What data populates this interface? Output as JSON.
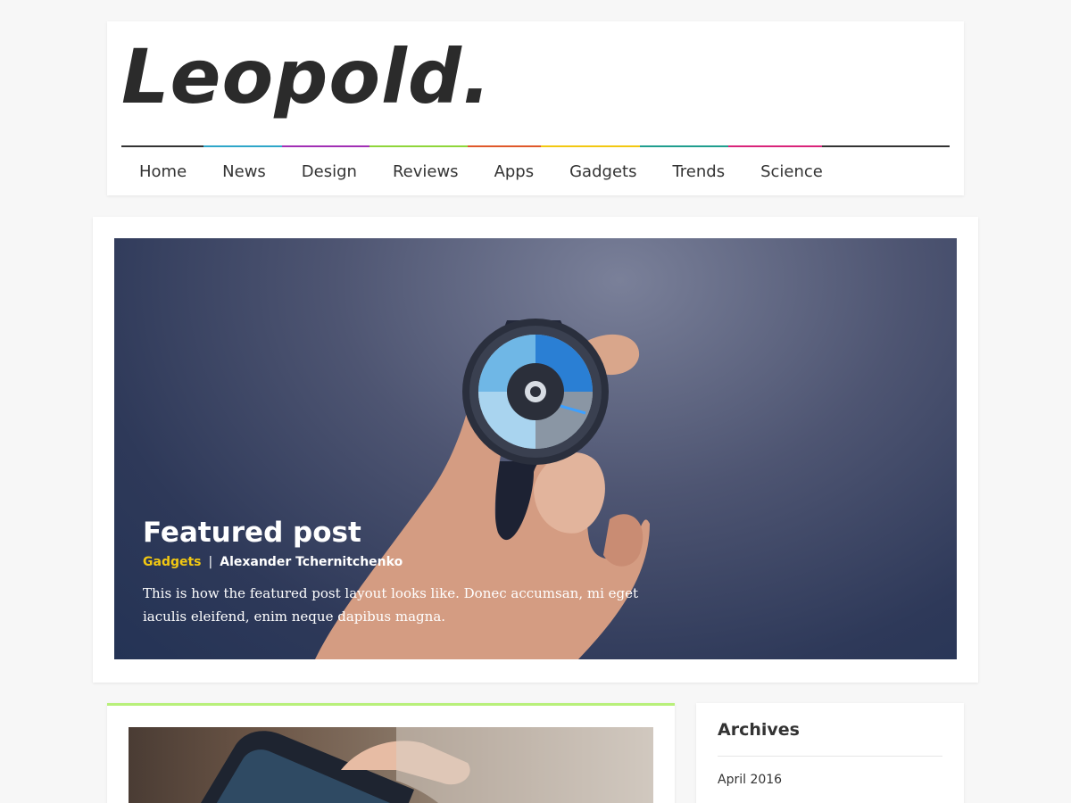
{
  "site": {
    "logo": "Leopold."
  },
  "nav": {
    "items": [
      {
        "label": "Home",
        "color": "#333333"
      },
      {
        "label": "News",
        "color": "#2fa6c9"
      },
      {
        "label": "Design",
        "color": "#a12fb5"
      },
      {
        "label": "Reviews",
        "color": "#8fd63a"
      },
      {
        "label": "Apps",
        "color": "#e0582a"
      },
      {
        "label": "Gadgets",
        "color": "#f2c811"
      },
      {
        "label": "Trends",
        "color": "#1f9e8e"
      },
      {
        "label": "Science",
        "color": "#d9247a"
      }
    ],
    "rule_tail_color": "#333333"
  },
  "featured": {
    "title": "Featured post",
    "category": "Gadgets",
    "separator": "|",
    "author": "Alexander Tchernitchenko",
    "excerpt": "This is how the featured post layout looks like. Donec accumsan, mi eget iaculis eleifend, enim neque dapibus magna.",
    "category_color": "#f2c811"
  },
  "post": {
    "accent_color": "#b8f07a"
  },
  "widget": {
    "title": "Archives",
    "links": [
      "April 2016"
    ]
  }
}
